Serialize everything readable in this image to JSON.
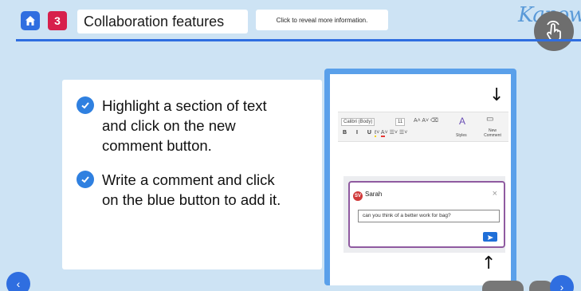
{
  "header": {
    "slide_number": "3",
    "title": "Collaboration features",
    "reveal_text": "Click to reveal more information.",
    "logo_text": "Kapow"
  },
  "bullets": [
    {
      "text": "Highlight a section of text and click on the new comment button."
    },
    {
      "text": "Write a comment and click on the blue button to add it."
    }
  ],
  "screenshot": {
    "ribbon": {
      "font_name": "Calibri (Body)",
      "font_size": "11",
      "format_row": "B I U",
      "styles_label": "Styles",
      "new_comment_label": "New Comment"
    },
    "comment": {
      "initials": "SV",
      "author": "Sarah",
      "input_value": "can you think of a better work for bag?",
      "close_glyph": "×"
    },
    "arrow_down": "↓",
    "arrow_up": "↑"
  },
  "nav": {
    "prev_glyph": "‹",
    "next_glyph": "›"
  },
  "colors": {
    "accent": "#2f6ee0",
    "badge": "#d7204c",
    "comment_border": "#8f5aa0",
    "send_button": "#1f6fd8"
  }
}
